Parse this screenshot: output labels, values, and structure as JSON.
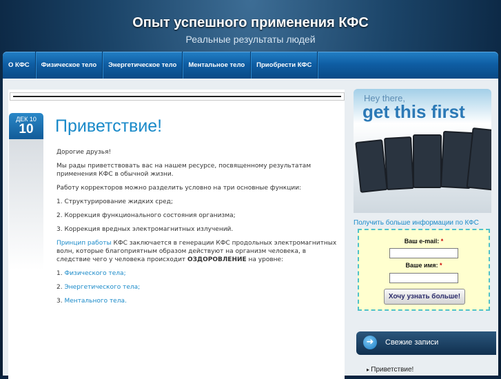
{
  "header": {
    "title": "Опыт успешного применения КФС",
    "subtitle": "Реальные результаты людей"
  },
  "nav": {
    "items": [
      {
        "label": "О КФС"
      },
      {
        "label": "Физическое тело"
      },
      {
        "label": "Энергетическое тело"
      },
      {
        "label": "Ментальное тело"
      },
      {
        "label": "Приобрести КФС"
      }
    ]
  },
  "post": {
    "date_month": "ДЕК 10",
    "date_day": "10",
    "title": "Приветствие!",
    "p1": "Дорогие друзья!",
    "p2": "Мы рады приветствовать вас на нашем ресурсе, посвященному результатам применения КФС в обычной жизни.",
    "p3": "Работу корректоров можно разделить условно на три основные функции:",
    "p4": "1. Структурирование жидких сред;",
    "p5": "2. Коррекция функционального состояния организма;",
    "p6": "3. Коррекция вредных электромагнитных излучений.",
    "p7_link": "Принцип работы",
    "p7_text": " КФС заключается в генерации КФС продольных электромагнитных волн, которые благоприятным образом действуют на организм человека, в следствие чего у человека происходит ",
    "p7_bold": "ОЗДОРОВЛЕНИЕ",
    "p7_end": " на уровне:",
    "l1_num": "1. ",
    "l1_link": "Физического тела;",
    "l2_num": "2. ",
    "l2_link": "Энергетического тела;",
    "l3_num": "3. ",
    "l3_link": "Ментального тела."
  },
  "sidebar": {
    "promo_hey": "Hey there,",
    "promo_main": "get this first",
    "info_title": "Получить больше информации по КФС",
    "form": {
      "email_label": "Ваш e-mail:",
      "name_label": "Ваше имя:",
      "required_mark": "*",
      "submit_label": "Хочу узнать больше!"
    },
    "widget_title": "Свежие записи",
    "widget_items": [
      "Приветствие!"
    ]
  },
  "colors": {
    "accent": "#1a8ac9",
    "nav": "#0f5ea4",
    "background": "#0b2642"
  }
}
